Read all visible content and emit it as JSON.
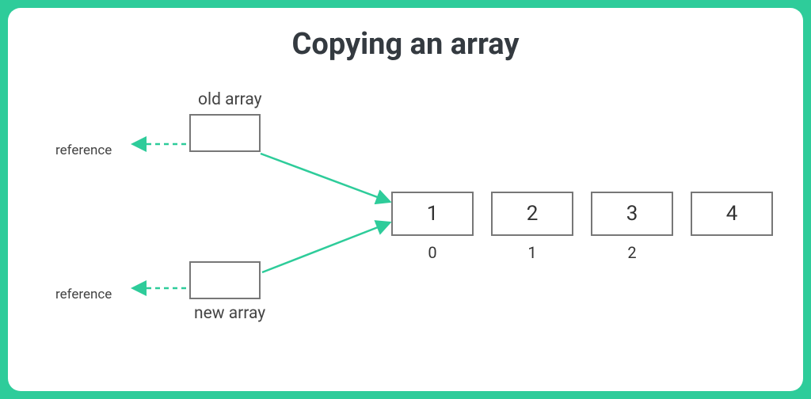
{
  "title": "Copying an array",
  "oldArray": {
    "label": "old array",
    "referenceLabel": "reference"
  },
  "newArray": {
    "label": "new array",
    "referenceLabel": "reference"
  },
  "cells": [
    {
      "value": "1",
      "index": "0"
    },
    {
      "value": "2",
      "index": "1"
    },
    {
      "value": "3",
      "index": "2"
    },
    {
      "value": "4",
      "index": ""
    }
  ],
  "colors": {
    "accent": "#2ecc9a",
    "text": "#343a40"
  }
}
